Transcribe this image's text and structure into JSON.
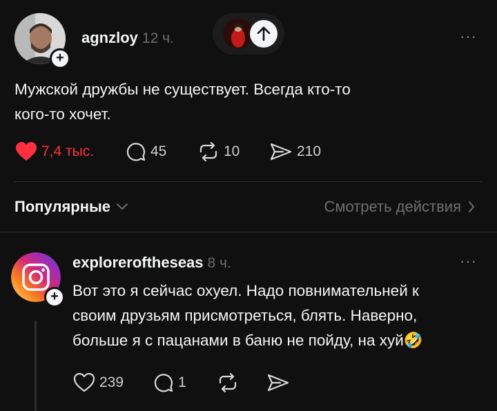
{
  "post": {
    "username": "agnzloy",
    "time": "12 ч.",
    "text_line1": "Мужской дружбы не существует. Всегда кто-то",
    "text_line2": "кого-то хочет.",
    "likes": "7,4 тыс.",
    "comments": "45",
    "reposts": "10",
    "shares": "210",
    "more": "···"
  },
  "sort_bar": {
    "label": "Популярные",
    "view_activity": "Смотреть действия"
  },
  "reply": {
    "username": "exploreroftheseas",
    "time": "8 ч.",
    "line1": "Вот это я сейчас охуел. Надо повнимательней к",
    "line2": "своим друзьям присмотреться, блять. Наверно,",
    "line3": "больше я с пацанами в баню не пойду, на хуй",
    "emoji": "🤣",
    "likes": "239",
    "comments": "1",
    "more": "···"
  },
  "colors": {
    "background": "#101010",
    "like_red": "#ff3040",
    "text": "#f3f5f7",
    "muted": "#6f6f6f"
  },
  "icons": [
    "plus-icon",
    "arrow-up-icon",
    "heart-icon",
    "comment-icon",
    "repost-icon",
    "share-icon",
    "chevron-down-icon",
    "chevron-right-icon",
    "instagram-logo-icon",
    "more-icon"
  ]
}
